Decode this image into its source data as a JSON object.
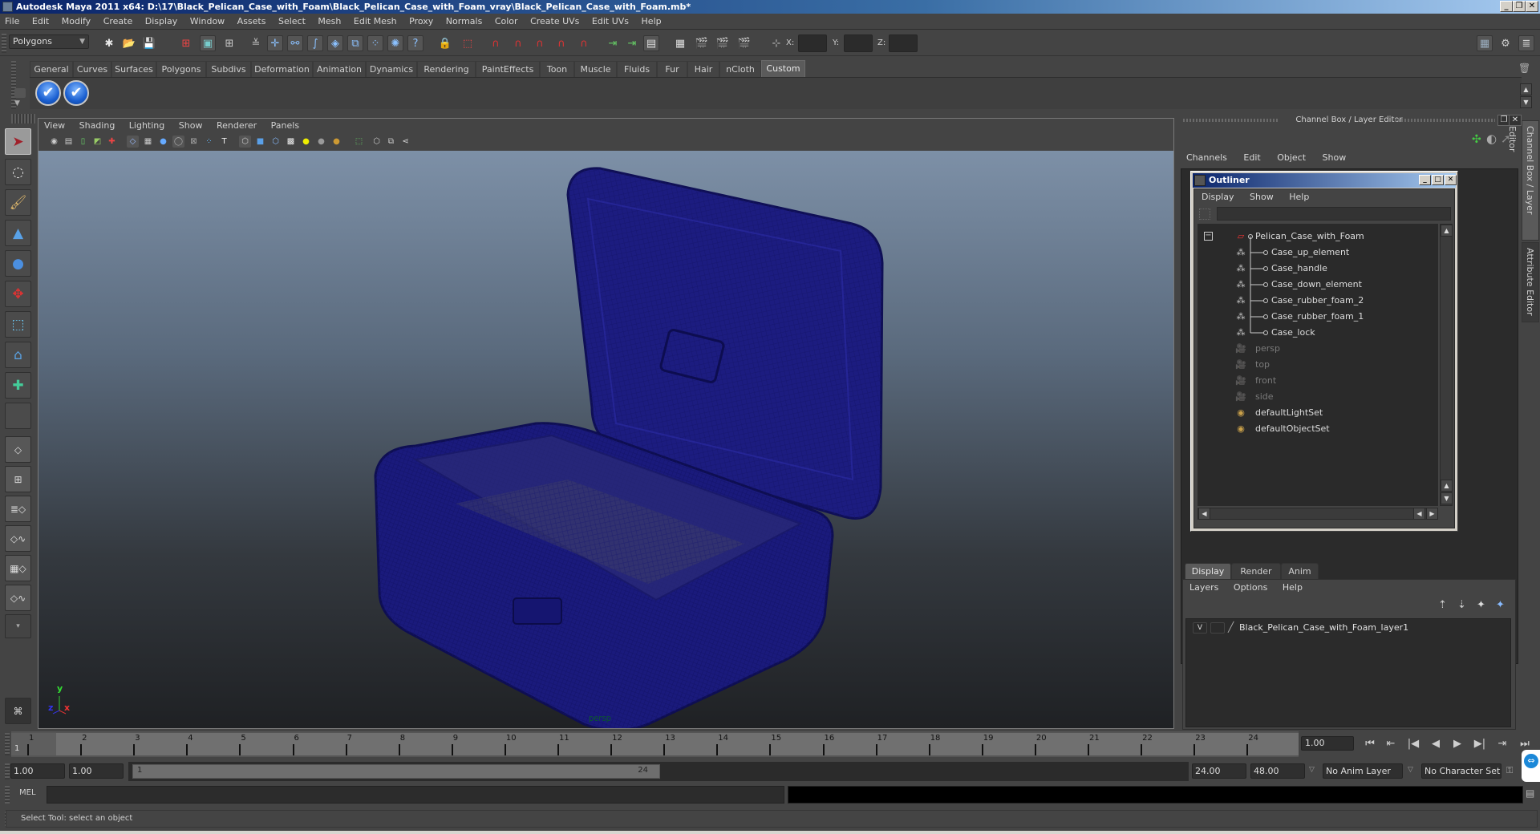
{
  "window": {
    "title": "Autodesk Maya 2011 x64: D:\\17\\Black_Pelican_Case_with_Foam\\Black_Pelican_Case_with_Foam_vray\\Black_Pelican_Case_with_Foam.mb*",
    "minimize": "_",
    "restore": "❐",
    "close": "✕"
  },
  "menubar": [
    "File",
    "Edit",
    "Modify",
    "Create",
    "Display",
    "Window",
    "Assets",
    "Select",
    "Mesh",
    "Edit Mesh",
    "Proxy",
    "Normals",
    "Color",
    "Create UVs",
    "Edit UVs",
    "Help"
  ],
  "toolbar": {
    "mode": "Polygons",
    "x_label": "X:",
    "y_label": "Y:",
    "z_label": "Z:",
    "x_value": "",
    "y_value": "",
    "z_value": ""
  },
  "shelf": {
    "tabs": [
      "General",
      "Curves",
      "Surfaces",
      "Polygons",
      "Subdivs",
      "Deformation",
      "Animation",
      "Dynamics",
      "Rendering",
      "PaintEffects",
      "Toon",
      "Muscle",
      "Fluids",
      "Fur",
      "Hair",
      "nCloth",
      "Custom"
    ],
    "active_tab": "Custom",
    "buttons": [
      "✔",
      "✔"
    ]
  },
  "viewport": {
    "menu": [
      "View",
      "Shading",
      "Lighting",
      "Show",
      "Renderer",
      "Panels"
    ],
    "camera_label": "persp",
    "axis": {
      "y": "y",
      "z": "z",
      "x": "x"
    },
    "wire_color": "#1a1a7a"
  },
  "channel_box": {
    "header": "Channel Box / Layer Editor",
    "menu": [
      "Channels",
      "Edit",
      "Object",
      "Show"
    ]
  },
  "outliner": {
    "title": "Outliner",
    "menu": [
      "Display",
      "Show",
      "Help"
    ],
    "collapse": "−",
    "items": [
      {
        "label": "Pelican_Case_with_Foam",
        "type": "group",
        "dim": false
      },
      {
        "label": "Case_up_element",
        "type": "mesh",
        "dim": false
      },
      {
        "label": "Case_handle",
        "type": "mesh",
        "dim": false
      },
      {
        "label": "Case_down_element",
        "type": "mesh",
        "dim": false
      },
      {
        "label": "Case_rubber_foam_2",
        "type": "mesh",
        "dim": false
      },
      {
        "label": "Case_rubber_foam_1",
        "type": "mesh",
        "dim": false
      },
      {
        "label": "Case_lock",
        "type": "mesh",
        "dim": false
      },
      {
        "label": "persp",
        "type": "camera",
        "dim": true
      },
      {
        "label": "top",
        "type": "camera",
        "dim": true
      },
      {
        "label": "front",
        "type": "camera",
        "dim": true
      },
      {
        "label": "side",
        "type": "camera",
        "dim": true
      },
      {
        "label": "defaultLightSet",
        "type": "set",
        "dim": false
      },
      {
        "label": "defaultObjectSet",
        "type": "set",
        "dim": false
      }
    ]
  },
  "layer_editor": {
    "tabs": [
      "Display",
      "Render",
      "Anim"
    ],
    "active_tab": "Display",
    "menu": [
      "Layers",
      "Options",
      "Help"
    ],
    "layers": [
      {
        "visible": "V",
        "name": "Black_Pelican_Case_with_Foam_layer1"
      }
    ]
  },
  "side_tabs": [
    "Channel Box / Layer Editor",
    "Attribute Editor"
  ],
  "timeline": {
    "frames": [
      1,
      2,
      3,
      4,
      5,
      6,
      7,
      8,
      9,
      10,
      11,
      12,
      13,
      14,
      15,
      16,
      17,
      18,
      19,
      20,
      21,
      22,
      23,
      24
    ],
    "current_frame_marker": "1",
    "current_time": "1.00",
    "range_start": "1.00",
    "playback_start": "1.00",
    "range_slider_start": "1",
    "range_slider_end": "24",
    "playback_end": "24.00",
    "range_end": "48.00",
    "anim_layer": "No Anim Layer",
    "character_set": "No Character Set",
    "playback_buttons": [
      "⏮",
      "⇤",
      "|◀",
      "◀",
      "▶",
      "▶|",
      "⇥",
      "⏭"
    ]
  },
  "command_line": {
    "label": "MEL",
    "input": "",
    "output": ""
  },
  "help_line": "Select Tool: select an object"
}
